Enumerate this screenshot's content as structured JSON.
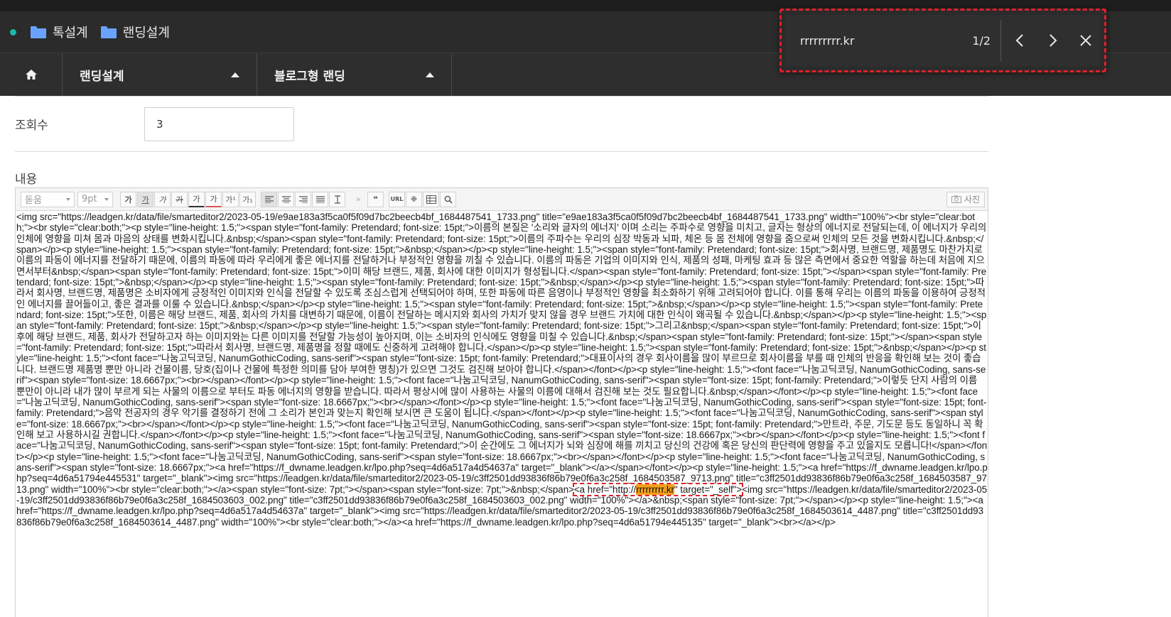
{
  "breadcrumb": {
    "items": [
      "톡설계",
      "랜딩설계"
    ]
  },
  "nav": {
    "dropdown1": "랜딩설계",
    "dropdown2": "블로그형 랜딩"
  },
  "find": {
    "query": "rrrrrrrrr.kr",
    "count": "1/2"
  },
  "form": {
    "views_label": "조회수",
    "views_value": "3",
    "content_label": "내용"
  },
  "editor": {
    "font_family": "돋움",
    "font_size": "9pt",
    "photo_button": "사진",
    "toolbar_buttons": [
      "가",
      "가",
      "가",
      "가",
      "가",
      "가",
      "가¹",
      "가₁"
    ],
    "source_parts": {
      "p1": "<img src=\"https://leadgen.kr/data/file/smarteditor2/2023-05-19/e9ae183a3f5ca0f5f09d7bc2beecb4bf_1684487541_1733.png\" title=\"e9ae183a3f5ca0f5f09d7bc2beecb4bf_1684487541_1733.png\" width=\"100%\"><br style=\"clear:both;\"><br style=\"clear:both;\"><p style=\"line-height: 1.5;\"><span style=\"font-family: Pretendard; font-size: 15pt;\">이름의 본질은 '소리와 글자의 에너지' 이며 소리는 주파수로 영향을 미치고, 글자는 형상의 에너지로 전달되는데, 이 에너지가 우리의 인체에 영향을 미쳐 몸과 마음의 상태를 변화시킵니다.&nbsp;</span><span style=\"font-family: Pretendard; font-size: 15pt;\">이름의 주파수는 우리의 심장 박동과 뇌파, 체온 등 몸 전체에 영향을 줌으로써 인체의 모든 것을 변화시킵니다.&nbsp;</span></p><p style=\"line-height: 1.5;\"><span style=\"font-family: Pretendard; font-size: 15pt;\">&nbsp;</span></p><p style=\"line-height: 1.5;\"><span style=\"font-family: Pretendard; font-size: 15pt;\">회사명, 브랜드명, 제품명도 마찬가지로 이름의 파동이 에너지를 전달하기 때문에, 이름의 파동에 따라 우리에게 좋은 에너지를 전달하거나 부정적인 영향을 끼칠 수 있습니다. 이름의 파동은 기업의 이미지와 인식, 제품의 성패, 마케팅 효과 등 많은 측면에서 중요한 역할을 하는데 처음에 지으면서부터&nbsp;</span><span style=\"font-family: Pretendard; font-size: 15pt;\">이미 해당 브랜드, 제품, 회사에 대한 이미지가 형성됩니다.</span><span style=\"font-family: Pretendard; font-size: 15pt;\"></span><span style=\"font-family: Pretendard; font-size: 15pt;\">&nbsp;</span></p><p style=\"line-height: 1.5;\"><span style=\"font-family: Pretendard; font-size: 15pt;\">&nbsp;</span></p><p style=\"line-height: 1.5;\"><span style=\"font-family: Pretendard; font-size: 15pt;\">따라서 회사명, 브랜드명, 제품명은 소비자에게 긍정적인 이미지와 인식을 전달할 수 있도록 조심스럽게 선택되어야 하며, 또한 파동에 따른 음영이나 부정적인 영향을 최소화하기 위해 고려되어야 합니다. 이를 통해 우리는 이름의 파동을 이용하여 긍정적인 에너지를 끌어들이고, 좋은 결과를 이룰 수 있습니다.&nbsp;</span></p><p style=\"line-height: 1.5;\"><span style=\"font-family: Pretendard; font-size: 15pt;\">&nbsp;</span></p><p style=\"line-height: 1.5;\"><span style=\"font-family: Pretendard; font-size: 15pt;\">또한, 이름은 해당 브랜드, 제품, 회사의 가치를 대변하기 때문에, 이름이 전달하는 메시지와 회사의 가치가 맞지 않을 경우 브랜드 가치에 대한 인식이 왜곡될 수 있습니다.&nbsp;</span></p><p style=\"line-height: 1.5;\"><span style=\"font-family: Pretendard; font-size: 15pt;\">&nbsp;</span></p><p style=\"line-height: 1.5;\"><span style=\"font-family: Pretendard; font-size: 15pt;\">그리고&nbsp;</span><span style=\"font-family: Pretendard; font-size: 15pt;\">이후에 해당 브랜드, 제품, 회사가 전달하고자 하는 이미지와는 다른 이미지를 전달할 가능성이 높아지며, 이는 소비자의 인식에도 영향을 미칠 수 있습니다.&nbsp;</span><span style=\"font-family: Pretendard; font-size: 15pt;\"></span><span style=\"font-family: Pretendard; font-size: 15pt;\">따라서 회사명, 브랜드명, 제품명을 정할 때에도 신중하게 고려해야 합니다.</span></p><p style=\"line-height: 1.5;\"><span style=\"font-family: Pretendard; font-size: 15pt;\">&nbsp;</span></p><p style=\"line-height: 1.5;\"><font face=\"나눔고딕코딩, NanumGothicCoding, sans-serif\"><span style=\"font-size: 15pt; font-family: Pretendard;\">대표이사의 경우 회사이름을 많이 부르므로 회사이름을 부를 때 인체의 반응을 확인해 보는 것이 좋습니다. 브랜드명 제품명 뿐만 아니라 건물이름, 당호(집이나 건물에 특정한 의미를 담아 부여한 명칭)가 있으면 그것도 검진해 보아야 합니다.</span></font></p><p style=\"line-height: 1.5;\"><font face=\"나눔고딕코딩, NanumGothicCoding, sans-serif\"><span style=\"font-size: 18.6667px;\"><br></span></font></p><p style=\"line-height: 1.5;\"><font face=\"나눔고딕코딩, NanumGothicCoding, sans-serif\"><span style=\"font-size: 15pt; font-family: Pretendard;\">이렇듯 단지 사람의 이름 뿐만이 아니라 내가 많이 부르게 되는 사물의 이름으로 부터도 파동 에너지의 영향을 받습니다. 따라서 평상시에 많이 사용하는 사물의 이름에 대해서 검진해 보는 것도 필요합니다.&nbsp;</span></font></p><p style=\"line-height: 1.5;\"><font face=\"나눔고딕코딩, NanumGothicCoding, sans-serif\"><span style=\"font-size: 18.6667px;\"><br></span></font></p><p style=\"line-height: 1.5;\"><font face=\"나눔고딕코딩, NanumGothicCoding, sans-serif\"><span style=\"font-size: 15pt; font-family: Pretendard;\">음악 전공자의 경우 악기를 결정하기 전에 그 소리가 본인과 맞는지 확인해 보시면 큰 도움이 됩니다.</span></font></p><p style=\"line-height: 1.5;\"><font face=\"나눔고딕코딩, NanumGothicCoding, sans-serif\"><span style=\"font-size: 18.6667px;\"><br></span></font></p><p style=\"line-height: 1.5;\"><font face=\"나눔고딕코딩, NanumGothicCoding, sans-serif\"><span style=\"font-size: 15pt; font-family: Pretendard;\">만트라, 주문, 기도문 등도 동일하니 꼭 확인해 보고 사용하시길 권합니다.</span></font></p><p style=\"line-height: 1.5;\"><font face=\"나눔고딕코딩, NanumGothicCoding, sans-serif\"><span style=\"font-size: 18.6667px;\"><br></span></font></p><p style=\"line-height: 1.5;\"><font face=\"나눔고딕코딩, NanumGothicCoding, sans-serif\"><span style=\"font-size: 15pt; font-family: Pretendard;\">이 순간에도 그 에너지가 뇌와 심장에 해를 끼치고 당신의 건강에 혹은 당신의 판단력에 영향을 주고 있을지도 모릅니다!</span></font></p><p style=\"line-height: 1.5;\"><font face=\"나눔고딕코딩, NanumGothicCoding, sans-serif\"><span style=\"font-size: 18.6667px;\"><br></span></font></p><p style=\"line-height: 1.5;\"><font face=\"나눔고딕코딩, NanumGothicCoding, sans-serif\"><span style=\"font-size: 18.6667px;\"><a href=\"https://f_dwname.leadgen.kr/lpo.php?seq=4d6a517a4d54637a\" target=\"_blank\"></a></span></font></p><p style=\"line-height: 1.5;\"><a href=\"https://f_dwname.leadgen.kr/lpo.php?seq=4d6a51794e445531\" target=\"_blank\"><img src=\"https://leadgen.kr/data/file/smarteditor2/2023-05-19/c3ff2501dd93836f86b79e0f6a3c258f_1684503587_9713.png\" title=\"c3ff2501dd93836f86b79e0f6a3c258f_1684503587_9713.png\" width=\"100%\"><br style=\"clear:both;\"></a><span style=\"font-size: 7pt;\"></span><span style=\"font-size: 7pt;\">&nbsp;</span>",
      "p2": "<a href=\"http://",
      "p3": "rrrrrrrrr.kr",
      "p4": "\" target=\"_self\">",
      "p5": "<img src=\"https://leadgen.kr/data/file/smarteditor2/2023-05-19/c3ff2501dd93836f86b79e0f6a3c258f_1684503603_002.png\" title=\"c3ff2501dd93836f86b79e0f6a3c258f_1684503603_002.png\" width=\"100%\"></a>&nbsp;<span style=\"font-size: 7pt;\"></span></p><p style=\"line-height: 1.5;\"><a href=\"https://f_dwname.leadgen.kr/lpo.php?seq=4d6a517a4d54637a\" target=\"_blank\"><img src=\"https://leadgen.kr/data/file/smarteditor2/2023-05-19/c3ff2501dd93836f86b79e0f6a3c258f_1684503614_4487.png\" title=\"c3ff2501dd93836f86b79e0f6a3c258f_1684503614_4487.png\" width=\"100%\"><br style=\"clear:both;\"></a><a href=\"https://f_dwname.leadgen.kr/lpo.php?seq=4d6a51794e445135\" target=\"_blank\"><br></a></p>"
    }
  },
  "colors": {
    "accent_teal": "#1fb6a6",
    "folder_blue": "#6aa3ff",
    "highlight_orange": "#f5a01a",
    "find_outline": "#e0202a"
  }
}
